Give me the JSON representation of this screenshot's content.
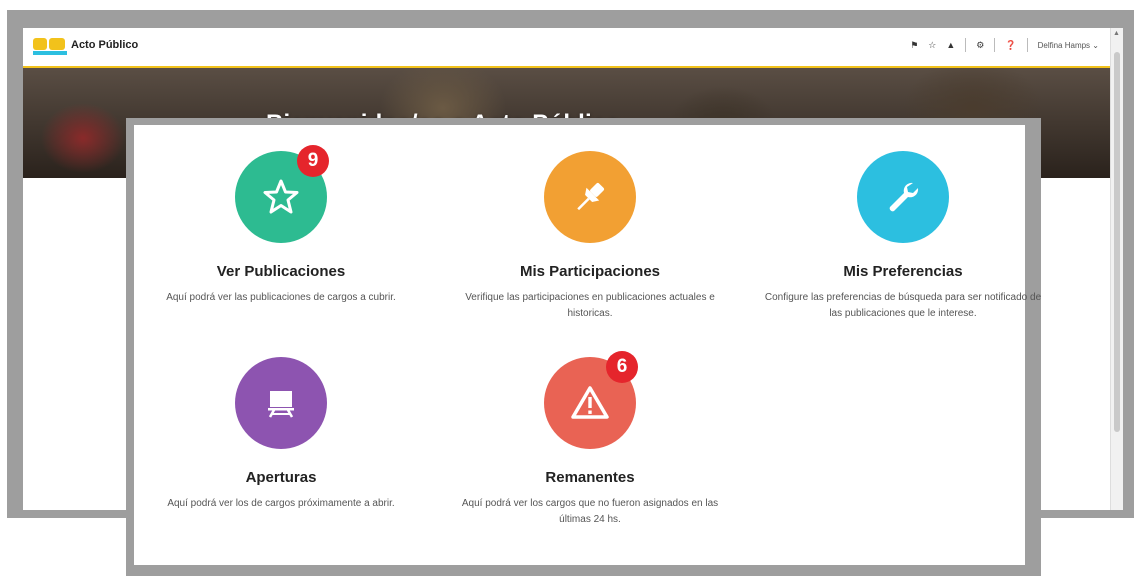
{
  "header": {
    "app_title": "Acto Público",
    "user_name": "Delfina Hamps",
    "nav_icons": [
      "home-icon",
      "star-icon",
      "bell-icon",
      "gear-icon",
      "help-icon"
    ]
  },
  "hero": {
    "title": "Bienvenidos/as a Acto Público"
  },
  "cards": [
    {
      "title": "Ver Publicaciones",
      "description": "Aquí podrá ver las publicaciones de cargos a cubrir.",
      "badge": "9",
      "color": "#2dbb91",
      "icon": "star-icon"
    },
    {
      "title": "Mis Participaciones",
      "description": "Verifique las participaciones en publicaciones actuales e historicas.",
      "badge": "",
      "color": "#f2a033",
      "icon": "pin-icon"
    },
    {
      "title": "Mis Preferencias",
      "description": "Configure las preferencias de búsqueda para ser notificado de las publicaciones que le interese.",
      "badge": "",
      "color": "#2cbfe0",
      "icon": "wrench-icon"
    },
    {
      "title": "Aperturas",
      "description": "Aquí podrá ver los de cargos próximamente a abrir.",
      "badge": "",
      "color": "#8d54b0",
      "icon": "easel-icon"
    },
    {
      "title": "Remanentes",
      "description": "Aquí podrá ver los cargos que no fueron asignados en las últimas 24 hs.",
      "badge": "6",
      "color": "#e96354",
      "icon": "warning-icon"
    }
  ],
  "colors": {
    "accent_yellow": "#f2c21b",
    "badge_red": "#e5252c"
  }
}
